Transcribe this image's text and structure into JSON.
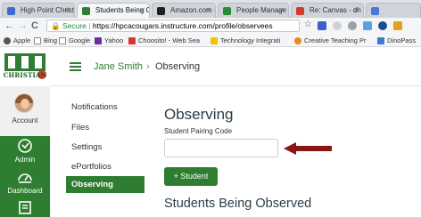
{
  "browser": {
    "tabs": [
      {
        "label": "High Point Christi",
        "color": "#3d6bd1"
      },
      {
        "label": "Students Being C",
        "color": "#2e7d31"
      },
      {
        "label": "Amazon.com - C",
        "color": "#1f1f1f"
      },
      {
        "label": "People Manage",
        "color": "#2a8a34"
      },
      {
        "label": "Re: Canvas - dh",
        "color": "#d23a2d"
      },
      {
        "label": "",
        "color": "#4a78d9"
      }
    ],
    "nav": {
      "back": "←",
      "forward": "→",
      "reload": "C"
    },
    "address": {
      "secure_label": "Secure",
      "url": "https://hpcacougars.instructure.com/profile/observees"
    },
    "bookmarks": [
      {
        "label": "Apple",
        "color": "#555555"
      },
      {
        "label": "Bing",
        "color": "#ffffff"
      },
      {
        "label": "Google",
        "color": "#ffffff"
      },
      {
        "label": "Yahoo",
        "color": "#6b2fa3"
      },
      {
        "label": "Choosito! - Web Sea",
        "color": "#d23a2d"
      },
      {
        "label": "Technology Integrati",
        "color": "#f2c200"
      },
      {
        "label": "Creative Teaching Pr",
        "color": "#e58a1e"
      },
      {
        "label": "DinoPass",
        "color": "#3a7bd5"
      }
    ]
  },
  "canvas": {
    "logo_text": "CHRISTIAN",
    "global_nav": [
      {
        "label": "Account",
        "icon": "avatar"
      },
      {
        "label": "Admin",
        "icon": "shield-icon"
      },
      {
        "label": "Dashboard",
        "icon": "dashboard-icon"
      },
      {
        "label": "",
        "icon": "courses-icon"
      }
    ],
    "breadcrumb": {
      "user": "Jane Smith",
      "separator": "›",
      "page": "Observing"
    },
    "sub_nav": [
      "Notifications",
      "Files",
      "Settings",
      "ePortfolios",
      "Observing"
    ],
    "active_sub_nav": "Observing",
    "page_title": "Observing",
    "pairing_code_label": "Student Pairing Code",
    "pairing_code_value": "",
    "add_button": "+ Student",
    "section_title": "Students Being Observed",
    "accent_color": "#2e7d31",
    "arrow_color": "#8b1414"
  }
}
